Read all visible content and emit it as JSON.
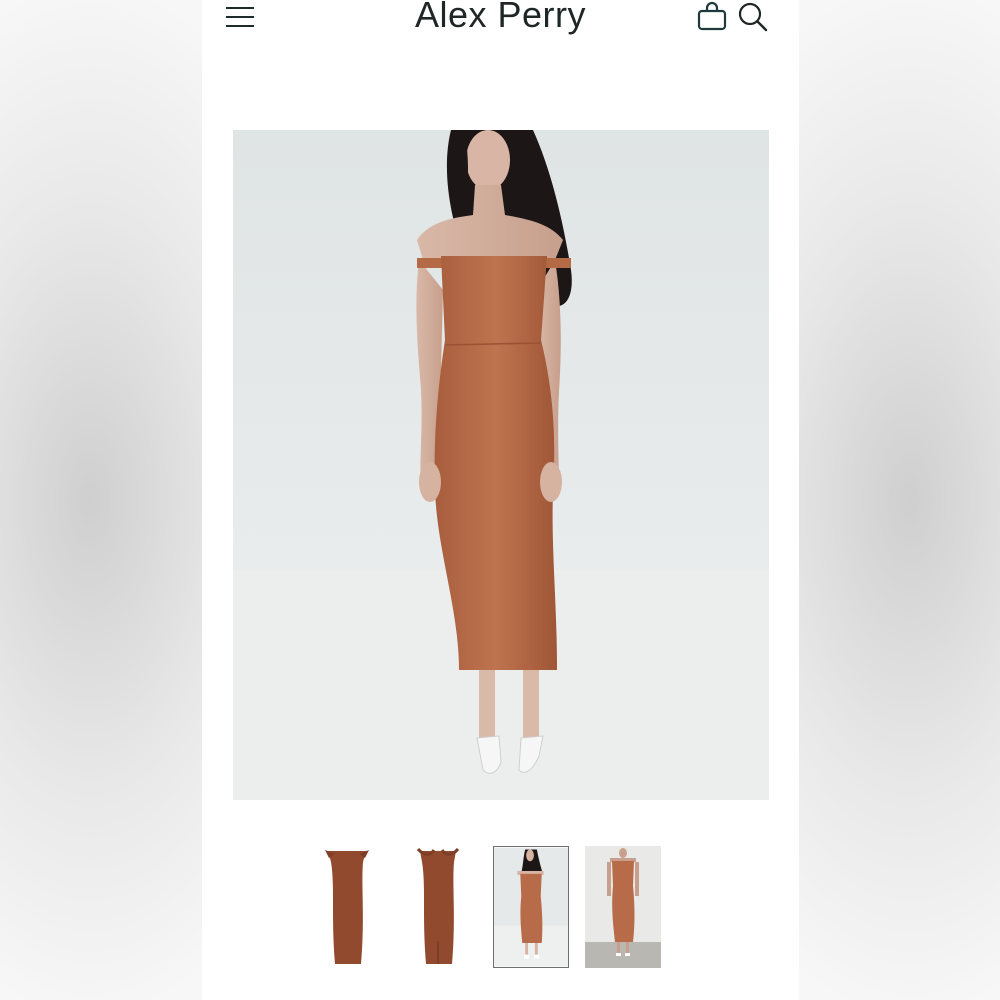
{
  "header": {
    "brand_name": "Alex Perry",
    "menu_icon": "hamburger-menu-icon",
    "bag_icon": "shopping-bag-icon",
    "search_icon": "search-icon"
  },
  "product": {
    "main_image": "model-in-terracotta-off-shoulder-midi-dress",
    "dress_color": "#b86b48",
    "thumbnails": [
      {
        "subject": "dress-front-flat",
        "selected": false
      },
      {
        "subject": "dress-back-flat",
        "selected": false
      },
      {
        "subject": "model-studio-white",
        "selected": true
      },
      {
        "subject": "model-studio-grey",
        "selected": false
      }
    ]
  },
  "colors": {
    "text": "#1f2626",
    "background": "#ffffff",
    "thumb_border": "#6f6f6f"
  }
}
